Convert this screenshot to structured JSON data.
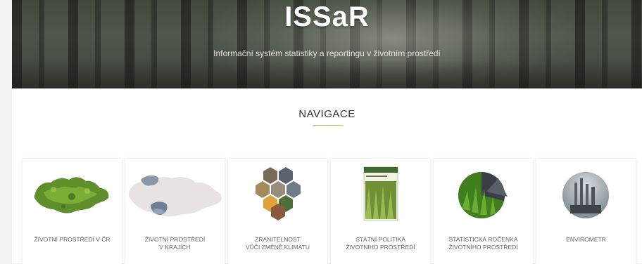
{
  "hero": {
    "title": "ISSaR",
    "subtitle": "Informační systém statistiky a reportingu v životním prostředí"
  },
  "navigation": {
    "heading": "NAVIGACE",
    "underline_color": "#c7c35a",
    "cards": [
      {
        "line1": "ŽIVOTNÍ PROSTŘEDÍ V ČR",
        "line2": "",
        "icon": "czech-map-green-icon"
      },
      {
        "line1": "ŽIVOTNÍ PROSTŘEDÍ",
        "line2": "V KRAJÍCH",
        "icon": "regions-map-icon"
      },
      {
        "line1": "ZRANITELNOST",
        "line2": "VŮČI ZMĚNĚ KLIMATU",
        "icon": "climate-hexagons-icon"
      },
      {
        "line1": "STÁTNÍ POLITIKA",
        "line2": "ŽIVOTNÍHO PROSTŘEDÍ",
        "icon": "policy-document-icon"
      },
      {
        "line1": "STATISTICKÁ ROČENKA",
        "line2": "ŽIVOTNÍHO PROSTŘEDÍ",
        "icon": "yearbook-pie-icon"
      },
      {
        "line1": "ENVIROMETR",
        "line2": "",
        "icon": "envirometr-factory-icon"
      }
    ]
  }
}
